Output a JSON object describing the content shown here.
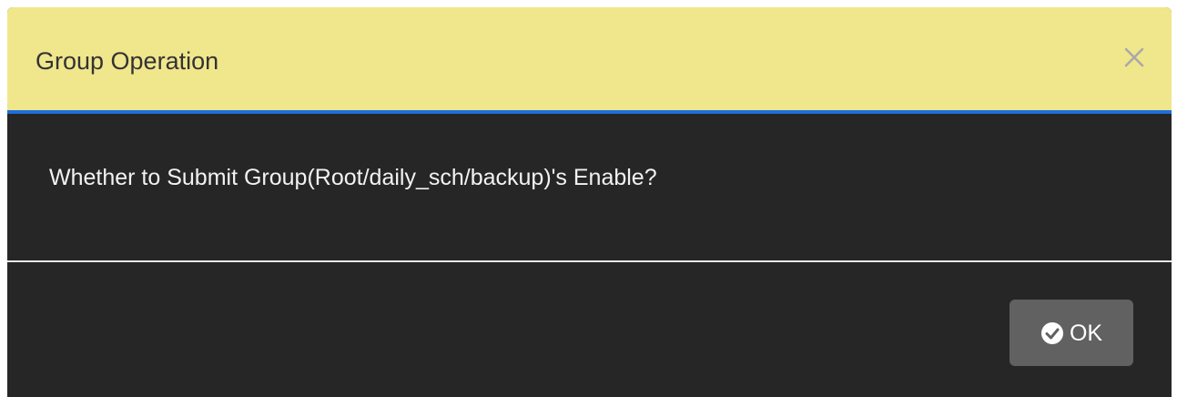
{
  "dialog": {
    "title": "Group Operation",
    "close_icon": "close-icon",
    "message": "Whether to Submit Group(Root/daily_sch/backup)'s Enable?",
    "ok_label": "OK",
    "ok_icon": "check-circle-icon",
    "colors": {
      "header_bg": "#f0e68c",
      "header_border": "#1e6fd9",
      "body_bg": "#262626",
      "button_bg": "#616161"
    }
  }
}
